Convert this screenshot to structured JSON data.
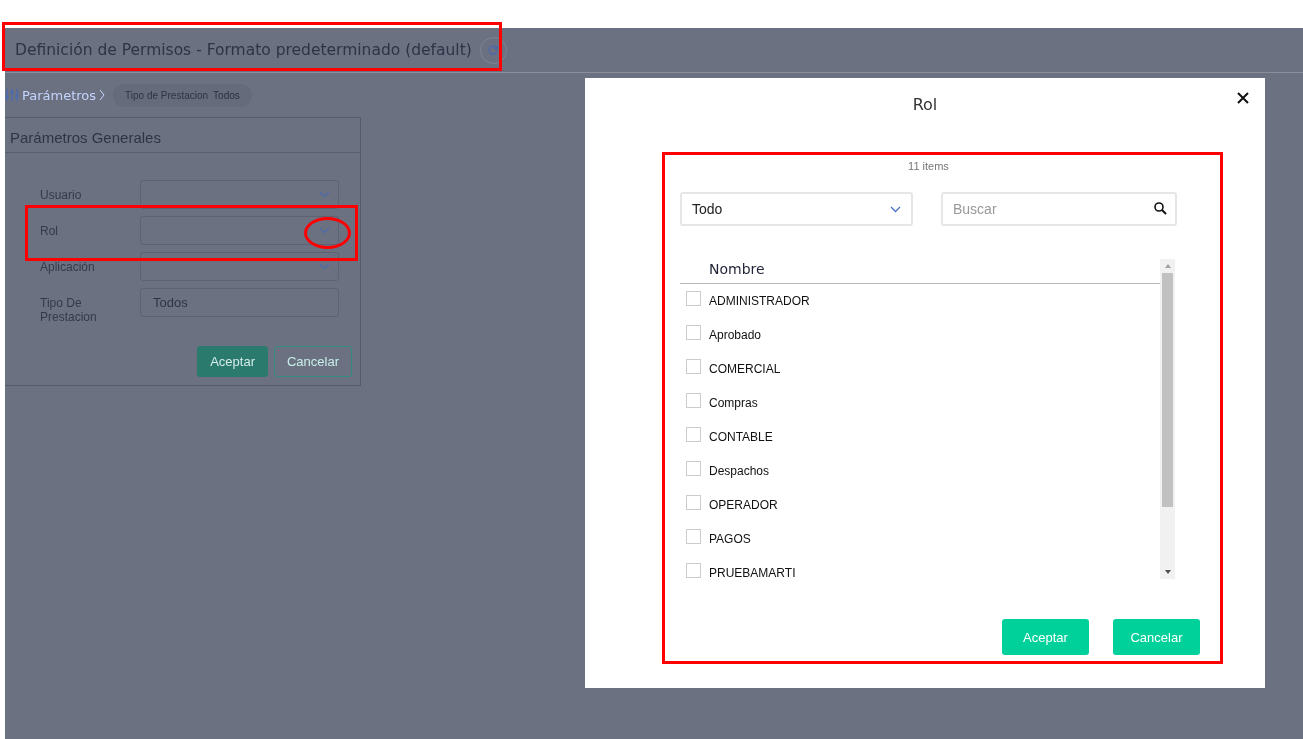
{
  "header": {
    "title": "Definición de Permisos - Formato predeterminado (default)"
  },
  "breadcrumb": {
    "label": "Parámetros",
    "chip_label": "Tipo de Prestacion",
    "chip_value": "Todos"
  },
  "panel": {
    "title": "Parámetros Generales",
    "fields": [
      {
        "label": "Usuario",
        "kind": "select"
      },
      {
        "label": "Rol",
        "kind": "select"
      },
      {
        "label": "Aplicación",
        "kind": "select"
      },
      {
        "label": "Tipo De Prestacion",
        "kind": "text",
        "value": "Todos"
      }
    ],
    "buttons": [
      {
        "label": "Aceptar",
        "kind": "primary"
      },
      {
        "label": "Cancelar",
        "kind": "outline"
      }
    ]
  },
  "modal": {
    "title": "Rol",
    "count": "11 items",
    "filter": "Todo",
    "search": {
      "placeholder": "Buscar"
    },
    "column": "Nombre",
    "rows": [
      {
        "name": "ADMINISTRADOR",
        "checked": false
      },
      {
        "name": "Aprobado",
        "checked": false
      },
      {
        "name": "COMERCIAL",
        "checked": false
      },
      {
        "name": "Compras",
        "checked": false
      },
      {
        "name": "CONTABLE",
        "checked": false
      },
      {
        "name": "Despachos",
        "checked": false
      },
      {
        "name": "OPERADOR",
        "checked": false
      },
      {
        "name": "PAGOS",
        "checked": false
      },
      {
        "name": "PRUEBAMARTI",
        "checked": false
      }
    ],
    "buttons": [
      {
        "label": "Aceptar"
      },
      {
        "label": "Cancelar"
      }
    ]
  }
}
